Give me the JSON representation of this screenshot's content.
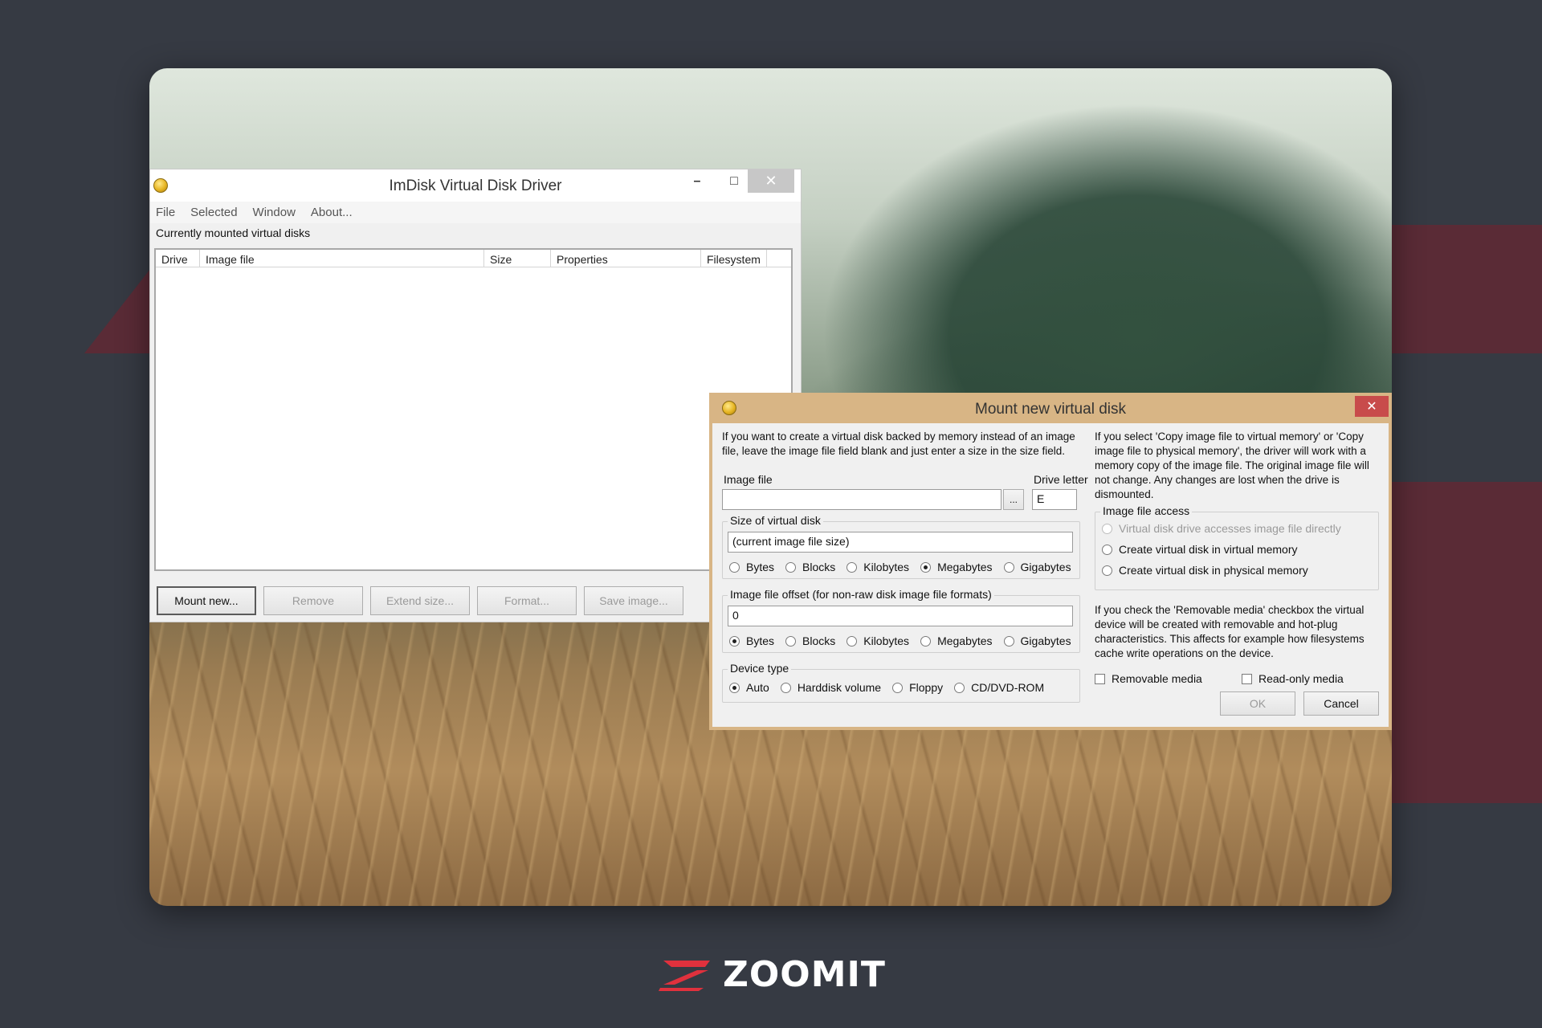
{
  "main_window": {
    "title": "ImDisk Virtual Disk Driver",
    "controls": {
      "minimize": "–",
      "maximize": "□",
      "close": "✕"
    },
    "menu": [
      "File",
      "Selected",
      "Window",
      "About..."
    ],
    "section_label": "Currently mounted virtual disks",
    "columns": [
      "Drive",
      "Image file",
      "Size",
      "Properties",
      "Filesystem"
    ],
    "buttons": [
      {
        "label": "Mount new...",
        "enabled": true
      },
      {
        "label": "Remove",
        "enabled": false
      },
      {
        "label": "Extend size...",
        "enabled": false
      },
      {
        "label": "Format...",
        "enabled": false
      },
      {
        "label": "Save image...",
        "enabled": false
      }
    ]
  },
  "dialog": {
    "title": "Mount new virtual disk",
    "close": "✕",
    "intro_text": "If you want to create a virtual disk backed by memory instead of an image file, leave the image file field blank and just enter a size in the size field.",
    "image_file_label": "Image file",
    "image_file_value": "",
    "browse_label": "...",
    "drive_letter_label": "Drive letter",
    "drive_letter_value": "E",
    "size_group": {
      "title": "Size of virtual disk",
      "value": "(current image file size)",
      "units": [
        "Bytes",
        "Blocks",
        "Kilobytes",
        "Megabytes",
        "Gigabytes"
      ],
      "selected": "Megabytes"
    },
    "offset_group": {
      "title": "Image file offset (for non-raw disk image file formats)",
      "value": "0",
      "units": [
        "Bytes",
        "Blocks",
        "Kilobytes",
        "Megabytes",
        "Gigabytes"
      ],
      "selected": "Bytes"
    },
    "device_group": {
      "title": "Device type",
      "options": [
        "Auto",
        "Harddisk volume",
        "Floppy",
        "CD/DVD-ROM"
      ],
      "selected": "Auto"
    },
    "copy_info_text": "If you select 'Copy image file to virtual memory' or 'Copy image file to physical memory', the driver will work with a memory copy of the image file. The original image file will not change. Any changes are lost when the drive is dismounted.",
    "access_group": {
      "title": "Image file access",
      "options": [
        {
          "label": "Virtual disk drive accesses image file directly",
          "enabled": false
        },
        {
          "label": "Create virtual disk in virtual memory",
          "enabled": true
        },
        {
          "label": "Create virtual disk in physical memory",
          "enabled": true
        }
      ]
    },
    "removable_info_text": "If you check the 'Removable media' checkbox the virtual device will be created with removable and hot-plug characteristics. This affects for example how filesystems cache write operations on the device.",
    "removable_label": "Removable media",
    "readonly_label": "Read-only media",
    "ok_label": "OK",
    "cancel_label": "Cancel"
  },
  "brand": {
    "name": "ZOOMIT",
    "accent": "#e0313d"
  },
  "colors": {
    "page_bg": "#363a43",
    "dialog_title": "#d8b585",
    "dialog_close": "#c84b4b"
  }
}
